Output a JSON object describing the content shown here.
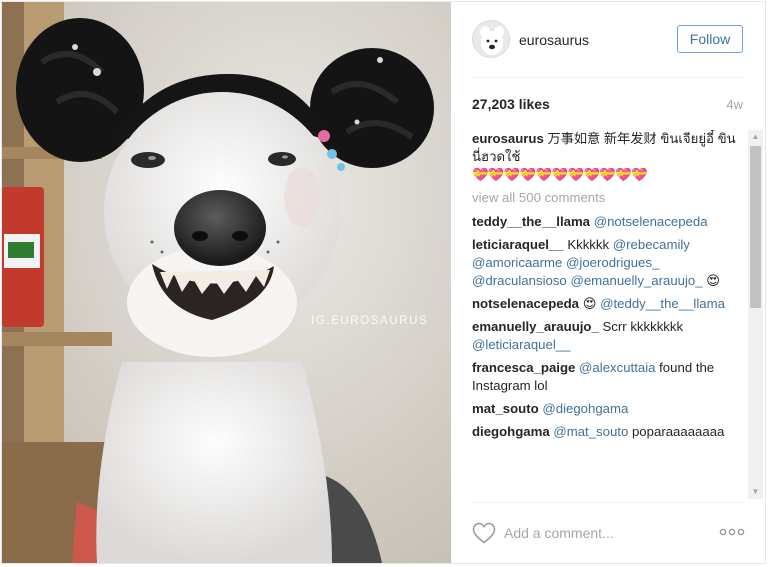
{
  "photo": {
    "watermark": "IG.EUROSAURUS",
    "alt_subject": "white dog wearing black yarn buns wig"
  },
  "header": {
    "username": "eurosaurus",
    "follow_label": "Follow"
  },
  "stats": {
    "likes": "27,203 likes",
    "age": "4w"
  },
  "caption": {
    "username": "eurosaurus",
    "text": "万事如意 新年发财 ขินเจียยู่อี๋ ขินนี่ฮวดใช้",
    "hearts": "💝💝💝💝💝💝💝💝💝💝💝"
  },
  "view_all_label": "view all 500 comments",
  "comments": [
    {
      "user": "teddy__the__llama",
      "parts": [
        {
          "t": "mention",
          "v": "@notselenacepeda"
        }
      ]
    },
    {
      "user": "leticiaraquel__",
      "parts": [
        {
          "t": "text",
          "v": "Kkkkkk "
        },
        {
          "t": "mention",
          "v": "@rebecamily"
        },
        {
          "t": "text",
          "v": " "
        },
        {
          "t": "mention",
          "v": "@amoricaarme"
        },
        {
          "t": "text",
          "v": " "
        },
        {
          "t": "mention",
          "v": "@joerodrigues_"
        },
        {
          "t": "text",
          "v": " "
        },
        {
          "t": "mention",
          "v": "@draculansioso"
        },
        {
          "t": "text",
          "v": " "
        },
        {
          "t": "mention",
          "v": "@emanuelly_arauujo_"
        },
        {
          "t": "text",
          "v": " 😍"
        }
      ]
    },
    {
      "user": "notselenacepeda",
      "parts": [
        {
          "t": "text",
          "v": "😍 "
        },
        {
          "t": "mention",
          "v": "@teddy__the__llama"
        }
      ]
    },
    {
      "user": "emanuelly_arauujo_",
      "parts": [
        {
          "t": "text",
          "v": "Scrr kkkkkkkk "
        },
        {
          "t": "mention",
          "v": "@leticiaraquel__"
        }
      ]
    },
    {
      "user": "francesca_paige",
      "parts": [
        {
          "t": "mention",
          "v": "@alexcuttaia"
        },
        {
          "t": "text",
          "v": " found the Instagram lol"
        }
      ]
    },
    {
      "user": "mat_souto",
      "parts": [
        {
          "t": "mention",
          "v": "@diegohgama"
        }
      ]
    },
    {
      "user": "diegohgama",
      "parts": [
        {
          "t": "mention",
          "v": "@mat_souto"
        },
        {
          "t": "text",
          "v": " poparaaaaaaaa"
        }
      ]
    }
  ],
  "footer": {
    "comment_placeholder": "Add a comment...",
    "like_icon": "heart-outline-icon",
    "more_icon": "ellipsis-icon"
  },
  "scrollbar": {
    "up_glyph": "▲",
    "down_glyph": "▼"
  },
  "colors": {
    "mention": "#3f729b",
    "follow_border": "#70a1d6",
    "muted": "#a5a7aa",
    "border": "#e6e6e6"
  }
}
